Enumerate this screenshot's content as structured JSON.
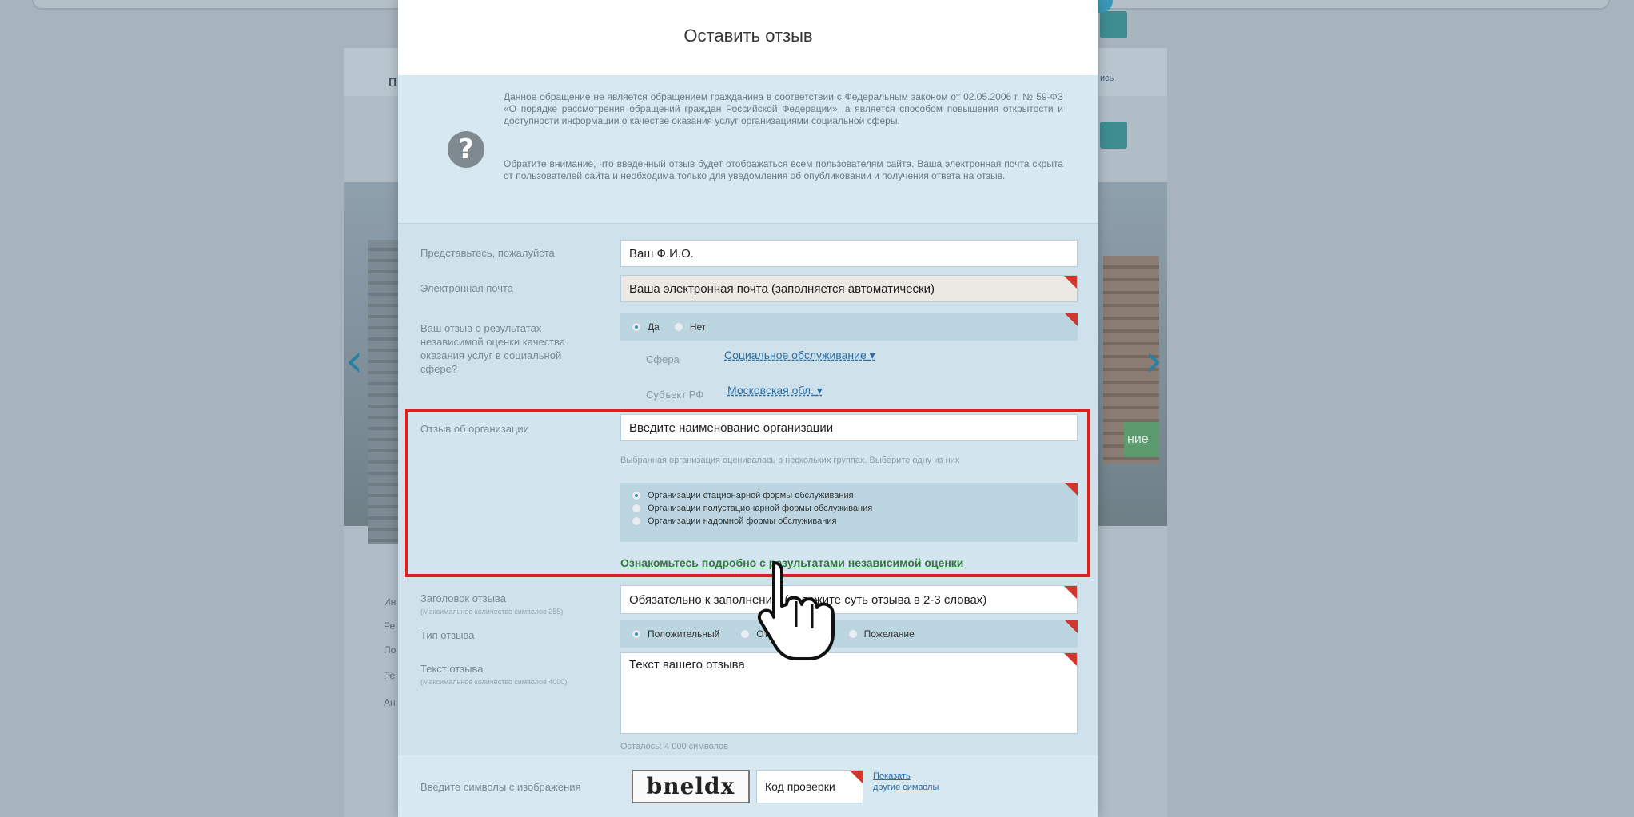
{
  "modal": {
    "title": "Оставить отзыв",
    "info_icon": "question-icon",
    "info_paragraph_1": "Данное обращение не является обращением гражданина в соответствии с Федеральным законом от 02.05.2006 г. № 59-ФЗ «О порядке рассмотрения обращений граждан Российской Федерации», а является способом повышения открытости и доступности информации о качестве оказания услуг организациями социальной сферы.",
    "info_paragraph_2": "Обратите внимание, что введенный отзыв будет отображаться всем пользователям сайта. Ваша электронная почта скрыта от пользователей сайта и необходима только для уведомления об опубликовании и получения ответа на отзыв."
  },
  "form": {
    "name": {
      "label": "Представьтесь, пожалуйста",
      "value": "Ваш Ф.И.О."
    },
    "email": {
      "label": "Электронная почта",
      "value": "Ваша электронная почта (заполняется автоматически)"
    },
    "independent": {
      "label": "Ваш отзыв о результатах независимой оценки качества оказания услуг в социальной сфере?",
      "options": [
        "Да",
        "Нет"
      ],
      "selected": "Да",
      "sphere_label": "Сфера",
      "sphere_value": "Социальное обслуживание",
      "subject_label": "Субъект РФ",
      "subject_value": "Московская обл."
    },
    "organization": {
      "label": "Отзыв об организации",
      "value": "Введите наименование организации",
      "hint": "Выбранная организация оценивалась в нескольких группах. Выберите одну из них",
      "groups": [
        "Организации стационарной формы обслуживания",
        "Организации полустационарной формы обслуживания",
        "Организации надомной формы обслуживания"
      ],
      "selected_group": "Организации стационарной формы обслуживания",
      "details_link": "Ознакомьтесь подробно с результатами независимой оценки"
    },
    "review_title": {
      "label": "Заголовок отзыва",
      "note": "(Максимальное количество символов 255)",
      "value": "Обязательно к заполнению (изложите суть отзыва в 2-3 словах)"
    },
    "review_type": {
      "label": "Тип отзыва",
      "options": [
        "Положительный",
        "Отрицательный",
        "Пожелание"
      ],
      "selected": "Положительный"
    },
    "review_text": {
      "label": "Текст отзыва",
      "note": "(Максимальное количество символов 4000)",
      "value": "Текст вашего отзыва",
      "remaining": "Осталось: 4 000 символов"
    },
    "captcha": {
      "label": "Введите символы с изображения",
      "image_text": "bneldx",
      "value": "Код проверки",
      "refresh_link_1": "Показать",
      "refresh_link_2": "другие символы"
    }
  },
  "background": {
    "left_nav_items": [
      "Ин",
      "Ре",
      "По",
      "Ре",
      "Ан"
    ],
    "right_link": "ись",
    "green_button": "ние",
    "prev_arrow": "‹",
    "next_arrow": "›",
    "header_letter": "П"
  },
  "colors": {
    "highlight": "#dc1f1f",
    "required_corner": "#d2372d",
    "modal_bg": "#d5e7ef",
    "green_link": "#2d7d3b",
    "blue_link": "#2b6ea4"
  }
}
